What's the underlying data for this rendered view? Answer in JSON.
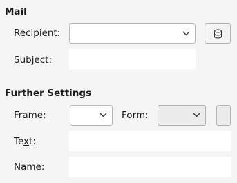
{
  "mail": {
    "title": "Mail",
    "recipient_label": {
      "pre": "Re",
      "ul": "c",
      "post": "ipient:"
    },
    "recipient_value": "",
    "subject_label": {
      "pre": "",
      "ul": "S",
      "post": "ubject:"
    },
    "subject_value": ""
  },
  "further": {
    "title": "Further Settings",
    "frame_label": {
      "pre": "F",
      "ul": "r",
      "post": "ame:"
    },
    "frame_value": "",
    "form_label": {
      "pre": "F",
      "ul": "o",
      "post": "rm:"
    },
    "form_value": "",
    "text_label": {
      "pre": "Te",
      "ul": "x",
      "post": "t:"
    },
    "text_value": "",
    "name_label": {
      "pre": "Na",
      "ul": "m",
      "post": "e:"
    },
    "name_value": ""
  },
  "icons": {
    "address_book": "database-icon",
    "dropdown": "chevron-down-icon"
  }
}
